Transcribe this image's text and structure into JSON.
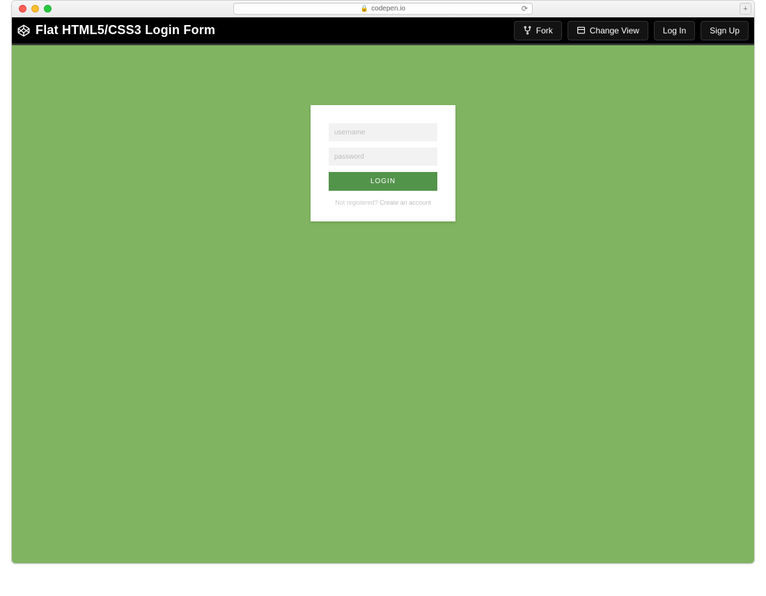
{
  "browser": {
    "url_host": "codepen.io"
  },
  "codepen": {
    "title": "Flat HTML5/CSS3 Login Form",
    "buttons": {
      "fork": "Fork",
      "change_view": "Change View",
      "log_in": "Log In",
      "sign_up": "Sign Up"
    }
  },
  "login_form": {
    "username_placeholder": "username",
    "password_placeholder": "password",
    "submit_label": "LOGIN",
    "footer_text": "Not registered? ",
    "footer_link": "Create an account"
  },
  "colors": {
    "preview_bg": "#80b461",
    "login_btn": "#53944b"
  }
}
